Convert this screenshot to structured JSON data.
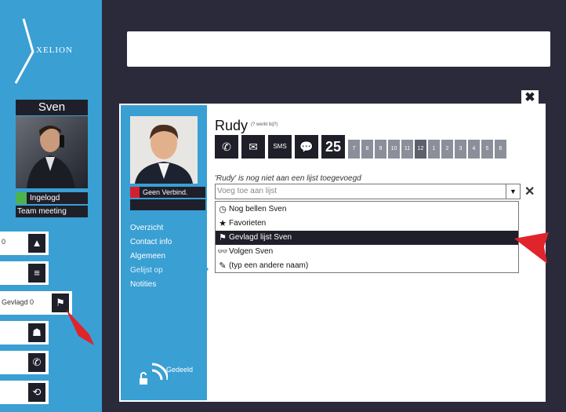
{
  "brand": {
    "name": "XELION"
  },
  "user": {
    "name": "Sven",
    "status": "Ingelogd",
    "meeting": "Team meeting"
  },
  "sidebar_buttons": [
    {
      "count": "0",
      "icon": "warning-icon",
      "glyph": "▲"
    },
    {
      "count": "",
      "icon": "list-icon",
      "glyph": "≡"
    },
    {
      "count": "",
      "icon": "people-icon",
      "glyph": "☗"
    },
    {
      "count": "",
      "icon": "phone-icon",
      "glyph": "✆"
    },
    {
      "count": "",
      "icon": "history-icon",
      "glyph": "⟲"
    }
  ],
  "flag_button": {
    "label": "Gevlagd",
    "count": "0",
    "glyph": "⚑"
  },
  "close_glyph": "✖",
  "contact": {
    "name": "Rudy",
    "sub": "(? werkt bij?)",
    "connection": "Geen Verbind.",
    "menu": [
      "Overzicht",
      "Contact info",
      "Algemeen",
      "Gelijst op",
      "Notities"
    ],
    "active_menu": "Gelijst op",
    "bottom_label": "Gedeeld"
  },
  "actions": [
    {
      "name": "call-icon",
      "glyph": "✆"
    },
    {
      "name": "mail-icon",
      "glyph": "✉"
    },
    {
      "name": "sms-icon",
      "glyph": "SMS"
    },
    {
      "name": "chat-icon",
      "glyph": "💬"
    }
  ],
  "date": "25",
  "time_slots": [
    "7",
    "8",
    "9",
    "10",
    "11",
    "12",
    "1",
    "2",
    "3",
    "4",
    "5",
    "6"
  ],
  "list_hint": "'Rudy' is nog niet aan een lijst toegevoegd",
  "combo": {
    "placeholder": "Voeg toe aan lijst",
    "arrow": "▼",
    "clear": "✕"
  },
  "dropdown": [
    {
      "icon": "clock-icon",
      "glyph": "◷",
      "label": "Nog bellen Sven"
    },
    {
      "icon": "star-icon",
      "glyph": "★",
      "label": "Favorieten"
    },
    {
      "icon": "flag-icon",
      "glyph": "⚑",
      "label": "Gevlagd lijst Sven"
    },
    {
      "icon": "follow-icon",
      "glyph": "👓",
      "label": "Volgen Sven"
    },
    {
      "icon": "pencil-icon",
      "glyph": "✎",
      "label": "(typ een andere naam)"
    }
  ],
  "selected_index": 2,
  "colors": {
    "accent": "#3a9fd3",
    "dark": "#1f1f2a",
    "highlight_arrow": "#e0242c"
  }
}
